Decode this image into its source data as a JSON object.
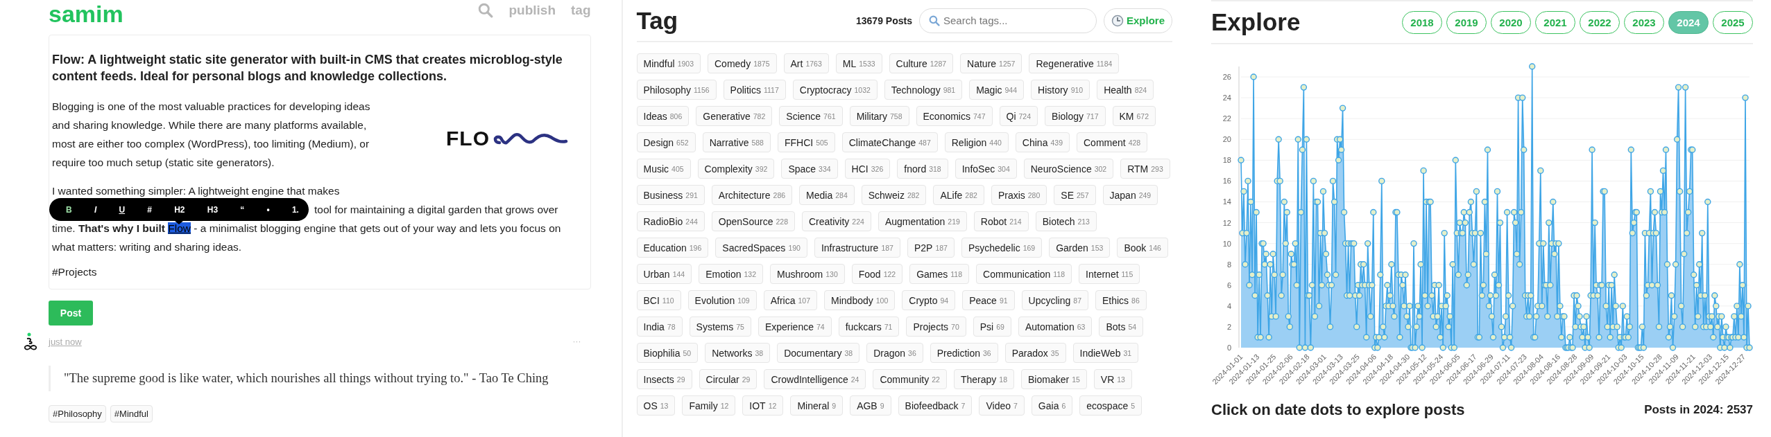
{
  "header": {
    "logo": "samim",
    "nav": [
      {
        "kind": "search"
      },
      {
        "kind": "link",
        "label": "publish"
      },
      {
        "kind": "link",
        "label": "tag"
      }
    ]
  },
  "editor": {
    "title": "Flow: A lightweight static site generator with built-in CMS that creates microblog-style content feeds. Ideal for personal blogs and knowledge collections.",
    "paragraph_1": "Blogging is one of the most valuable practices for developing ideas and sharing knowledge. While there are many platforms available, most are either too complex (WordPress), too limiting (Medium), or require too much setup (static site generators).",
    "logo_text": "FLO",
    "paragraph_2": {
      "line_1": "I wanted something simpler: A lightweight engine that makes",
      "line_2": "tool for maintaining a digital garden that grows over",
      "before": "time. **That's why I built** ",
      "selection": "Flow",
      "after": " - a minimalist blogging engine that gets out of your way and lets you focus on what matters: writing and sharing ideas."
    },
    "hashtag": "#Projects",
    "toolbar": [
      {
        "label": "B",
        "kind": "bold",
        "active": true
      },
      {
        "label": "I",
        "kind": "italic",
        "active": false
      },
      {
        "label": "U",
        "kind": "underline",
        "active": false
      },
      {
        "label": "#",
        "kind": "plain",
        "active": false
      },
      {
        "label": "H2",
        "kind": "plain",
        "active": false
      },
      {
        "label": "H3",
        "kind": "plain",
        "active": false
      },
      {
        "label": "“",
        "kind": "plain",
        "active": false
      },
      {
        "label": "•",
        "kind": "plain",
        "active": false
      },
      {
        "label": "1.",
        "kind": "plain",
        "active": false
      }
    ]
  },
  "post_button": "Post",
  "post": {
    "time": "just now",
    "menu": "···",
    "quote": "\"The supreme good is like water, which nourishes all things without trying to.\" - Tao Te Ching",
    "tags": [
      "#Philosophy",
      "#Mindful"
    ]
  },
  "tag_panel": {
    "title": "Tag",
    "count": "13679 Posts",
    "search": {
      "placeholder": "Search tags..."
    },
    "explore_button": "Explore",
    "tags": [
      {
        "name": "Mindful",
        "count": "1903"
      },
      {
        "name": "Comedy",
        "count": "1875"
      },
      {
        "name": "Art",
        "count": "1763"
      },
      {
        "name": "ML",
        "count": "1533"
      },
      {
        "name": "Culture",
        "count": "1287"
      },
      {
        "name": "Nature",
        "count": "1257"
      },
      {
        "name": "Regenerative",
        "count": "1184"
      },
      {
        "name": "Philosophy",
        "count": "1156"
      },
      {
        "name": "Politics",
        "count": "1117"
      },
      {
        "name": "Cryptocracy",
        "count": "1032"
      },
      {
        "name": "Technology",
        "count": "981"
      },
      {
        "name": "Magic",
        "count": "944"
      },
      {
        "name": "History",
        "count": "910"
      },
      {
        "name": "Health",
        "count": "824"
      },
      {
        "name": "Ideas",
        "count": "806"
      },
      {
        "name": "Generative",
        "count": "782"
      },
      {
        "name": "Science",
        "count": "761"
      },
      {
        "name": "Military",
        "count": "758"
      },
      {
        "name": "Economics",
        "count": "747"
      },
      {
        "name": "Qi",
        "count": "724"
      },
      {
        "name": "Biology",
        "count": "717"
      },
      {
        "name": "KM",
        "count": "672"
      },
      {
        "name": "Design",
        "count": "652"
      },
      {
        "name": "Narrative",
        "count": "588"
      },
      {
        "name": "FFHCI",
        "count": "505"
      },
      {
        "name": "ClimateChange",
        "count": "487"
      },
      {
        "name": "Religion",
        "count": "440"
      },
      {
        "name": "China",
        "count": "439"
      },
      {
        "name": "Comment",
        "count": "428"
      },
      {
        "name": "Music",
        "count": "405"
      },
      {
        "name": "Complexity",
        "count": "392"
      },
      {
        "name": "Space",
        "count": "334"
      },
      {
        "name": "HCI",
        "count": "326"
      },
      {
        "name": "fnord",
        "count": "318"
      },
      {
        "name": "InfoSec",
        "count": "304"
      },
      {
        "name": "NeuroScience",
        "count": "302"
      },
      {
        "name": "RTM",
        "count": "293"
      },
      {
        "name": "Business",
        "count": "291"
      },
      {
        "name": "Architecture",
        "count": "286"
      },
      {
        "name": "Media",
        "count": "284"
      },
      {
        "name": "Schweiz",
        "count": "282"
      },
      {
        "name": "ALife",
        "count": "282"
      },
      {
        "name": "Praxis",
        "count": "280"
      },
      {
        "name": "SE",
        "count": "257"
      },
      {
        "name": "Japan",
        "count": "249"
      },
      {
        "name": "RadioBio",
        "count": "244"
      },
      {
        "name": "OpenSource",
        "count": "228"
      },
      {
        "name": "Creativity",
        "count": "224"
      },
      {
        "name": "Augmentation",
        "count": "219"
      },
      {
        "name": "Robot",
        "count": "214"
      },
      {
        "name": "Biotech",
        "count": "213"
      },
      {
        "name": "Education",
        "count": "196"
      },
      {
        "name": "SacredSpaces",
        "count": "190"
      },
      {
        "name": "Infrastructure",
        "count": "187"
      },
      {
        "name": "P2P",
        "count": "187"
      },
      {
        "name": "Psychedelic",
        "count": "169"
      },
      {
        "name": "Garden",
        "count": "153"
      },
      {
        "name": "Book",
        "count": "146"
      },
      {
        "name": "Urban",
        "count": "144"
      },
      {
        "name": "Emotion",
        "count": "132"
      },
      {
        "name": "Mushroom",
        "count": "130"
      },
      {
        "name": "Food",
        "count": "122"
      },
      {
        "name": "Games",
        "count": "118"
      },
      {
        "name": "Communication",
        "count": "118"
      },
      {
        "name": "Internet",
        "count": "115"
      },
      {
        "name": "BCI",
        "count": "110"
      },
      {
        "name": "Evolution",
        "count": "109"
      },
      {
        "name": "Africa",
        "count": "107"
      },
      {
        "name": "Mindbody",
        "count": "100"
      },
      {
        "name": "Crypto",
        "count": "94"
      },
      {
        "name": "Peace",
        "count": "91"
      },
      {
        "name": "Upcycling",
        "count": "87"
      },
      {
        "name": "Ethics",
        "count": "86"
      },
      {
        "name": "India",
        "count": "78"
      },
      {
        "name": "Systems",
        "count": "75"
      },
      {
        "name": "Experience",
        "count": "74"
      },
      {
        "name": "fuckcars",
        "count": "71"
      },
      {
        "name": "Projects",
        "count": "70"
      },
      {
        "name": "Psi",
        "count": "69"
      },
      {
        "name": "Automation",
        "count": "63"
      },
      {
        "name": "Bots",
        "count": "54"
      },
      {
        "name": "Biophilia",
        "count": "50"
      },
      {
        "name": "Networks",
        "count": "38"
      },
      {
        "name": "Documentary",
        "count": "38"
      },
      {
        "name": "Dragon",
        "count": "36"
      },
      {
        "name": "Prediction",
        "count": "36"
      },
      {
        "name": "Paradox",
        "count": "35"
      },
      {
        "name": "IndieWeb",
        "count": "31"
      },
      {
        "name": "Insects",
        "count": "29"
      },
      {
        "name": "Circular",
        "count": "29"
      },
      {
        "name": "CrowdIntelligence",
        "count": "24"
      },
      {
        "name": "Community",
        "count": "22"
      },
      {
        "name": "Therapy",
        "count": "18"
      },
      {
        "name": "Biomaker",
        "count": "15"
      },
      {
        "name": "VR",
        "count": "13"
      },
      {
        "name": "OS",
        "count": "13"
      },
      {
        "name": "Family",
        "count": "12"
      },
      {
        "name": "IOT",
        "count": "12"
      },
      {
        "name": "Mineral",
        "count": "9"
      },
      {
        "name": "AGB",
        "count": "9"
      },
      {
        "name": "Biofeedback",
        "count": "7"
      },
      {
        "name": "Video",
        "count": "7"
      },
      {
        "name": "Gaia",
        "count": "6"
      },
      {
        "name": "ecospace",
        "count": "5"
      }
    ]
  },
  "explore_panel": {
    "title": "Explore",
    "years": [
      {
        "label": "2018",
        "selected": false
      },
      {
        "label": "2019",
        "selected": false
      },
      {
        "label": "2020",
        "selected": false
      },
      {
        "label": "2021",
        "selected": false
      },
      {
        "label": "2022",
        "selected": false
      },
      {
        "label": "2023",
        "selected": false
      },
      {
        "label": "2024",
        "selected": true
      },
      {
        "label": "2025",
        "selected": false
      }
    ],
    "chart_data": {
      "type": "area",
      "grid": true,
      "ylim": [
        0,
        27
      ],
      "yticks": [
        0,
        2,
        4,
        6,
        8,
        10,
        12,
        14,
        16,
        18,
        20,
        22,
        24,
        26
      ],
      "categories": [
        "2024-01-01",
        null,
        null,
        null,
        null,
        null,
        null,
        null,
        null,
        null,
        null,
        null,
        "2024-01-13",
        null,
        null,
        null,
        null,
        null,
        null,
        null,
        null,
        null,
        null,
        null,
        "2024-01-25",
        null,
        null,
        null,
        null,
        null,
        null,
        null,
        null,
        null,
        null,
        null,
        "2024-02-06",
        null,
        null,
        null,
        null,
        null,
        null,
        null,
        null,
        null,
        null,
        null,
        "2024-02-18",
        null,
        null,
        null,
        null,
        null,
        null,
        null,
        null,
        null,
        null,
        null,
        "2024-03-01",
        null,
        null,
        null,
        null,
        null,
        null,
        null,
        null,
        null,
        null,
        null,
        "2024-03-13",
        null,
        null,
        null,
        null,
        null,
        null,
        null,
        null,
        null,
        null,
        null,
        "2024-03-25",
        null,
        null,
        null,
        null,
        null,
        null,
        null,
        null,
        null,
        null,
        null,
        "2024-04-06",
        null,
        null,
        null,
        null,
        null,
        null,
        null,
        null,
        null,
        null,
        null,
        "2024-04-18",
        null,
        null,
        null,
        null,
        null,
        null,
        null,
        null,
        null,
        null,
        null,
        "2024-04-30",
        null,
        null,
        null,
        null,
        null,
        null,
        null,
        null,
        null,
        null,
        null,
        "2024-05-12",
        null,
        null,
        null,
        null,
        null,
        null,
        null,
        null,
        null,
        null,
        null,
        "2024-05-24",
        null,
        null,
        null,
        null,
        null,
        null,
        null,
        null,
        null,
        null,
        null,
        "2024-06-05",
        null,
        null,
        null,
        null,
        null,
        null,
        null,
        null,
        null,
        null,
        null,
        "2024-06-17",
        null,
        null,
        null,
        null,
        null,
        null,
        null,
        null,
        null,
        null,
        null,
        "2024-06-29",
        null,
        null,
        null,
        null,
        null,
        null,
        null,
        null,
        null,
        null,
        null,
        "2024-07-11",
        null,
        null,
        null,
        null,
        null,
        null,
        null,
        null,
        null,
        null,
        null,
        "2024-07-23",
        null,
        null,
        null,
        null,
        null,
        null,
        null,
        null,
        null,
        null,
        null,
        "2024-08-04",
        null,
        null,
        null,
        null,
        null,
        null,
        null,
        null,
        null,
        null,
        null,
        "2024-08-16",
        null,
        null,
        null,
        null,
        null,
        null,
        null,
        null,
        null,
        null,
        null,
        "2024-08-28",
        null,
        null,
        null,
        null,
        null,
        null,
        null,
        null,
        null,
        null,
        null,
        "2024-09-09",
        null,
        null,
        null,
        null,
        null,
        null,
        null,
        null,
        null,
        null,
        null,
        "2024-09-21",
        null,
        null,
        null,
        null,
        null,
        null,
        null,
        null,
        null,
        null,
        null,
        "2024-10-03",
        null,
        null,
        null,
        null,
        null,
        null,
        null,
        null,
        null,
        null,
        null,
        "2024-10-15",
        null,
        null,
        null,
        null,
        null,
        null,
        null,
        null,
        null,
        null,
        null,
        null,
        "2024-10-28",
        null,
        null,
        null,
        null,
        null,
        null,
        null,
        null,
        null,
        null,
        null,
        "2024-11-09",
        null,
        null,
        null,
        null,
        null,
        null,
        null,
        null,
        null,
        null,
        null,
        "2024-11-21",
        null,
        null,
        null,
        null,
        null,
        null,
        null,
        null,
        null,
        null,
        null,
        "2024-12-03",
        null,
        null,
        null,
        null,
        null,
        null,
        null,
        null,
        null,
        null,
        null,
        "2024-12-15",
        null,
        null,
        null,
        null,
        null,
        null,
        null,
        null,
        null,
        null,
        null,
        "2024-12-27",
        null,
        null,
        null,
        null
      ],
      "series": [
        {
          "color": "#3ea5e6",
          "values": [
            18,
            11,
            15,
            8,
            11,
            16,
            6,
            14,
            7,
            26,
            5,
            13,
            1,
            7,
            1,
            10,
            10,
            8,
            9,
            5,
            1,
            8,
            3,
            9,
            7,
            3,
            16,
            20,
            16,
            5,
            7,
            14,
            10,
            13,
            3,
            2,
            9,
            8,
            8,
            10,
            6,
            20,
            0,
            13,
            19,
            25,
            0,
            20,
            5,
            5,
            0,
            6,
            16,
            3,
            14,
            14,
            4,
            11,
            6,
            15,
            11,
            9,
            7,
            6,
            2,
            6,
            16,
            14,
            7,
            20,
            18,
            20,
            19,
            23,
            13,
            10,
            5,
            10,
            5,
            10,
            10,
            10,
            5,
            2,
            6,
            5,
            8,
            6,
            8,
            6,
            1,
            10,
            6,
            3,
            6,
            13,
            0,
            1,
            0,
            1,
            7,
            16,
            2,
            1,
            4,
            6,
            4,
            5,
            8,
            4,
            3,
            13,
            13,
            7,
            1,
            7,
            6,
            4,
            7,
            3,
            2,
            4,
            0,
            0,
            10,
            0,
            2,
            4,
            3,
            8,
            0,
            17,
            5,
            14,
            4,
            14,
            14,
            5,
            3,
            6,
            2,
            3,
            6,
            1,
            4,
            0,
            11,
            4,
            5,
            2,
            3,
            0,
            8,
            0,
            18,
            11,
            7,
            12,
            11,
            11,
            13,
            12,
            6,
            7,
            13,
            14,
            11,
            8,
            11,
            15,
            1,
            1,
            11,
            5,
            6,
            14,
            9,
            19,
            4,
            5,
            3,
            1,
            7,
            5,
            15,
            6,
            12,
            2,
            0,
            1,
            3,
            13,
            5,
            1,
            0,
            4,
            13,
            12,
            9,
            24,
            8,
            13,
            24,
            19,
            5,
            3,
            5,
            3,
            5,
            27,
            1,
            1,
            3,
            4,
            10,
            17,
            4,
            10,
            6,
            6,
            3,
            12,
            6,
            10,
            14,
            9,
            10,
            3,
            10,
            4,
            1,
            3,
            3,
            0,
            0,
            0,
            1,
            0,
            0,
            5,
            2,
            5,
            4,
            3,
            2,
            1,
            2,
            0,
            3,
            1,
            0,
            5,
            19,
            5,
            12,
            6,
            5,
            1,
            6,
            6,
            15,
            15,
            4,
            2,
            6,
            1,
            6,
            2,
            7,
            4,
            2,
            0,
            1,
            0,
            4,
            1,
            1,
            3,
            1,
            2,
            19,
            11,
            12,
            13,
            13,
            0,
            0,
            0,
            2,
            0,
            11,
            5,
            6,
            11,
            15,
            6,
            11,
            13,
            11,
            6,
            2,
            15,
            13,
            17,
            13,
            19,
            8,
            1,
            2,
            5,
            0,
            3,
            8,
            20,
            25,
            15,
            4,
            2,
            9,
            25,
            11,
            13,
            15,
            19,
            19,
            7,
            2,
            6,
            3,
            8,
            5,
            11,
            2,
            5,
            2,
            14,
            3,
            2,
            3,
            1,
            5,
            4,
            2,
            3,
            0,
            3,
            1,
            0,
            2,
            1,
            1,
            0,
            1,
            1,
            3,
            1,
            4,
            1,
            8,
            3,
            6,
            1,
            24,
            0,
            4,
            0
          ]
        }
      ]
    },
    "hint": "Click on date dots to explore posts",
    "total": "Posts in 2024: 2537"
  }
}
